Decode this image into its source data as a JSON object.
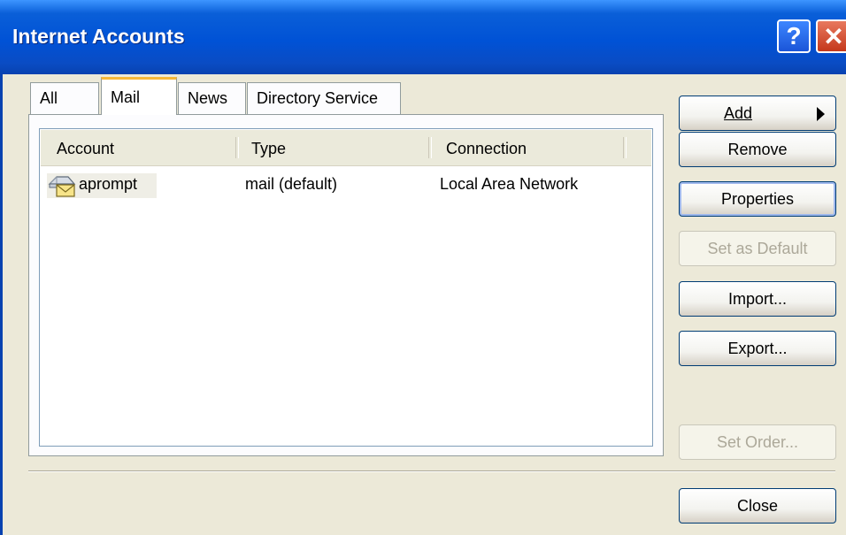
{
  "window": {
    "title": "Internet Accounts",
    "help_icon": "help-icon",
    "close_icon": "close-icon"
  },
  "tabs": [
    {
      "label": "All"
    },
    {
      "label": "Mail",
      "selected": true
    },
    {
      "label": "News"
    },
    {
      "label": "Directory Service"
    }
  ],
  "list": {
    "columns": [
      "Account",
      "Type",
      "Connection"
    ],
    "rows": [
      {
        "account": "aprompt",
        "type": "mail (default)",
        "connection": "Local Area Network",
        "icon": "mail-account-icon"
      }
    ]
  },
  "buttons": {
    "add": "Add",
    "remove": "Remove",
    "properties": "Properties",
    "set_default": "Set as Default",
    "import": "Import...",
    "export": "Export...",
    "set_order": "Set Order...",
    "close": "Close"
  },
  "colors": {
    "titlebar": "#0052d6",
    "tab_accent": "#f6b838",
    "dialog_bg": "#ece9d8"
  }
}
